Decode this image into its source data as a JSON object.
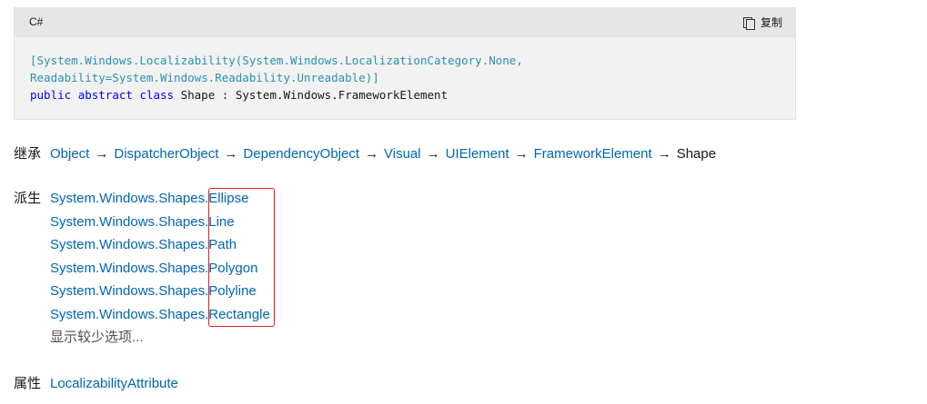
{
  "code_block": {
    "language": "C#",
    "copy_label": "复制",
    "line1_attr": "[System.Windows.Localizability(System.Windows.LocalizationCategory.None,",
    "line2_attr": "Readability=System.Windows.Readability.Unreadable)]",
    "kw_public": "public",
    "kw_abstract": "abstract",
    "kw_class": "class",
    "line3_rest": "Shape : System.Windows.FrameworkElement"
  },
  "inheritance": {
    "label": "继承",
    "chain": [
      "Object",
      "DispatcherObject",
      "DependencyObject",
      "Visual",
      "UIElement",
      "FrameworkElement"
    ],
    "current": "Shape",
    "arrow": "→"
  },
  "derived": {
    "label": "派生",
    "namespace": "System.Windows.Shapes.",
    "items": [
      "Ellipse",
      "Line",
      "Path",
      "Polygon",
      "Polyline",
      "Rectangle"
    ],
    "show_less": "显示较少选项..."
  },
  "attributes": {
    "label": "属性",
    "items": [
      "LocalizabilityAttribute"
    ]
  },
  "colors": {
    "link": "#0065b3",
    "highlight_border": "#e02020",
    "code_bg": "#f2f2f2"
  }
}
